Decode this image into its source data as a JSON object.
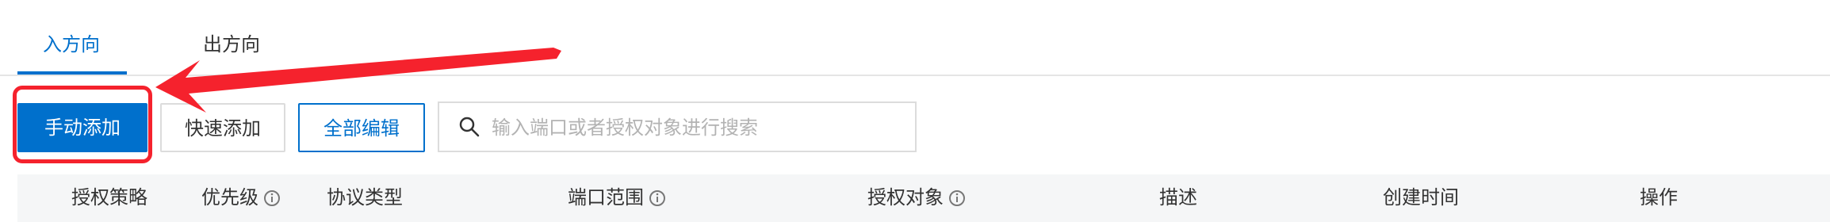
{
  "tabs": [
    {
      "label": "入方向",
      "active": true
    },
    {
      "label": "出方向",
      "active": false
    }
  ],
  "toolbar": {
    "manual_add_label": "手动添加",
    "quick_add_label": "快速添加",
    "edit_all_label": "全部编辑",
    "search_placeholder": "输入端口或者授权对象进行搜索"
  },
  "table": {
    "columns": [
      "授权策略",
      "优先级",
      "协议类型",
      "端口范围",
      "授权对象",
      "描述",
      "创建时间",
      "操作"
    ]
  },
  "annotation": {
    "arrow_color": "#f5222d",
    "highlight_color": "#f5222d"
  },
  "colors": {
    "primary": "#0070cc",
    "border": "#dcdcdc",
    "header_bg": "#f5f6f7"
  }
}
